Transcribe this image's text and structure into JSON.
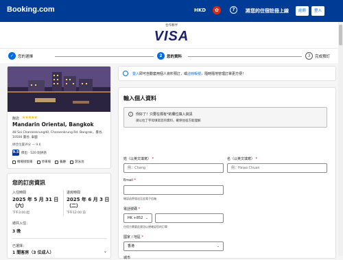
{
  "header": {
    "logo": "Booking.com",
    "currency": "HKD",
    "flag_icon": "hk-flag-icon",
    "help_icon": "question-icon",
    "list_property": "將您的住宿註冊上線",
    "register": "註冊",
    "login": "登入",
    "bg_color": "#003b95"
  },
  "partner": {
    "label": "合作夥伴",
    "brand": "VISA"
  },
  "steps": [
    {
      "num": "✓",
      "label": "您的選擇",
      "state": "done"
    },
    {
      "num": "2",
      "label": "您的資料",
      "state": "active"
    },
    {
      "num": "3",
      "label": "完成預訂",
      "state": "todo"
    }
  ],
  "hotel": {
    "type": "飯店",
    "stars": "★★★★★",
    "name": "Mandarin Oriental, Bangkok",
    "address": "48 Soi Charoenkrung40, Charoenkrung Rd. Bangrak，曼谷, 10500 曼谷, 泰國",
    "location": "絕佳位置評分 — 9.6",
    "score": "9.5",
    "score_text": "傑出 · 520 則評語",
    "amenities": [
      "機場接駁車",
      "停車場",
      "餐廳",
      "游泳池"
    ]
  },
  "booking": {
    "title": "您的訂房資訊",
    "checkin_label": "入住時間",
    "checkin_date": "2025 年 5 月 31 日（六）",
    "checkin_time": "下午3:00 起",
    "checkout_label": "退房時間",
    "checkout_date": "2025 年 6 月 3 日（二）",
    "checkout_time": "下午12:00 前",
    "stay_label": "總共入住：",
    "stay": "3 晚",
    "selected_label": "已選擇：",
    "selected": "1 間客房（3 位成人）"
  },
  "signin": {
    "login_link": "登入",
    "text": "即可自動套用個人資料預訂，或",
    "register_link": "註冊帳號",
    "text2": "，隨時隨地管理訂單更方便！"
  },
  "form": {
    "title": "輸入個人資料",
    "notice_1": "你好了！只要在標有*的欄位填入資訊",
    "notice_2": "請以拉丁字母填寫您的資料，確保住宿方能理解",
    "last_name_label": "姓（以英文填寫）",
    "last_name_placeholder": "例：Chang",
    "first_name_label": "名（以英文填寫）",
    "first_name_placeholder": "例：Hsiao Chuan",
    "email_label": "Email",
    "email_hint": "確認函將發送至此電子信箱",
    "phone_label": "電話號碼",
    "phone_code": "HK +852",
    "phone_hint": "住宿方需要此資訊以便確認您的訂單",
    "country_label": "國家 / 地區",
    "country_value": "香港",
    "city_label": "城市"
  }
}
